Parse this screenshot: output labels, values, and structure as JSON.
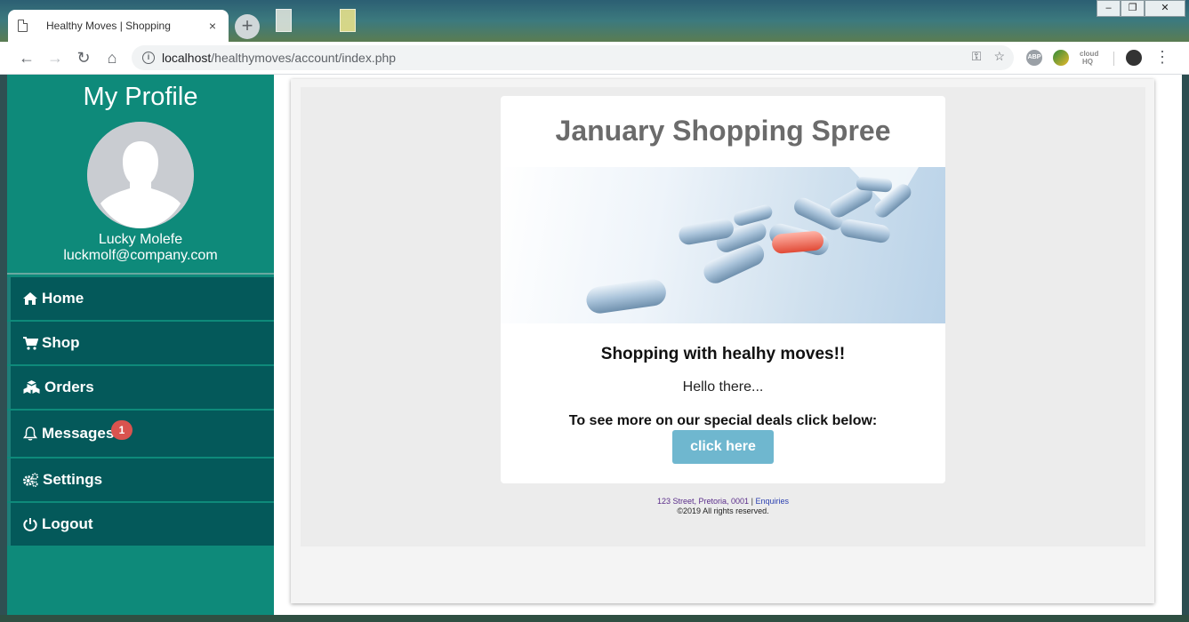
{
  "browser": {
    "tab_title": "Healthy Moves | Shopping",
    "tab_close": "×",
    "new_tab": "+",
    "url_host": "localhost",
    "url_path": "/healthymoves/account/index.php",
    "ext_abp": "ABP",
    "ext_hq": "cloud HQ",
    "window_minimize": "–",
    "window_maximize": "❐",
    "window_close": "✕"
  },
  "sidebar": {
    "title": "My Profile",
    "user_name": "Lucky Molefe",
    "user_email": "luckmolf@company.com",
    "items": [
      {
        "label": "Home",
        "icon": "home-icon"
      },
      {
        "label": "Shop",
        "icon": "cart-icon"
      },
      {
        "label": "Orders",
        "icon": "boxes-icon"
      },
      {
        "label": "Messages",
        "icon": "bell-icon",
        "badge": "1"
      },
      {
        "label": "Settings",
        "icon": "gears-icon"
      },
      {
        "label": "Logout",
        "icon": "power-icon"
      }
    ]
  },
  "email": {
    "title": "January Shopping Spree",
    "subtitle": "Shopping with healhy moves!!",
    "greeting": "Hello there...",
    "deals_text": "To see more on our special deals click below:",
    "cta_label": "click here",
    "footer_address": "123 Street, Pretoria, 0001",
    "footer_separator": "|",
    "footer_link": "Enquiries",
    "footer_copyright": "©2019 All rights reserved."
  },
  "colors": {
    "sidebar_bg": "#0e8a7a",
    "menu_bg": "#04595a",
    "cta_bg": "#6fb7cf",
    "badge_bg": "#d9534f"
  }
}
